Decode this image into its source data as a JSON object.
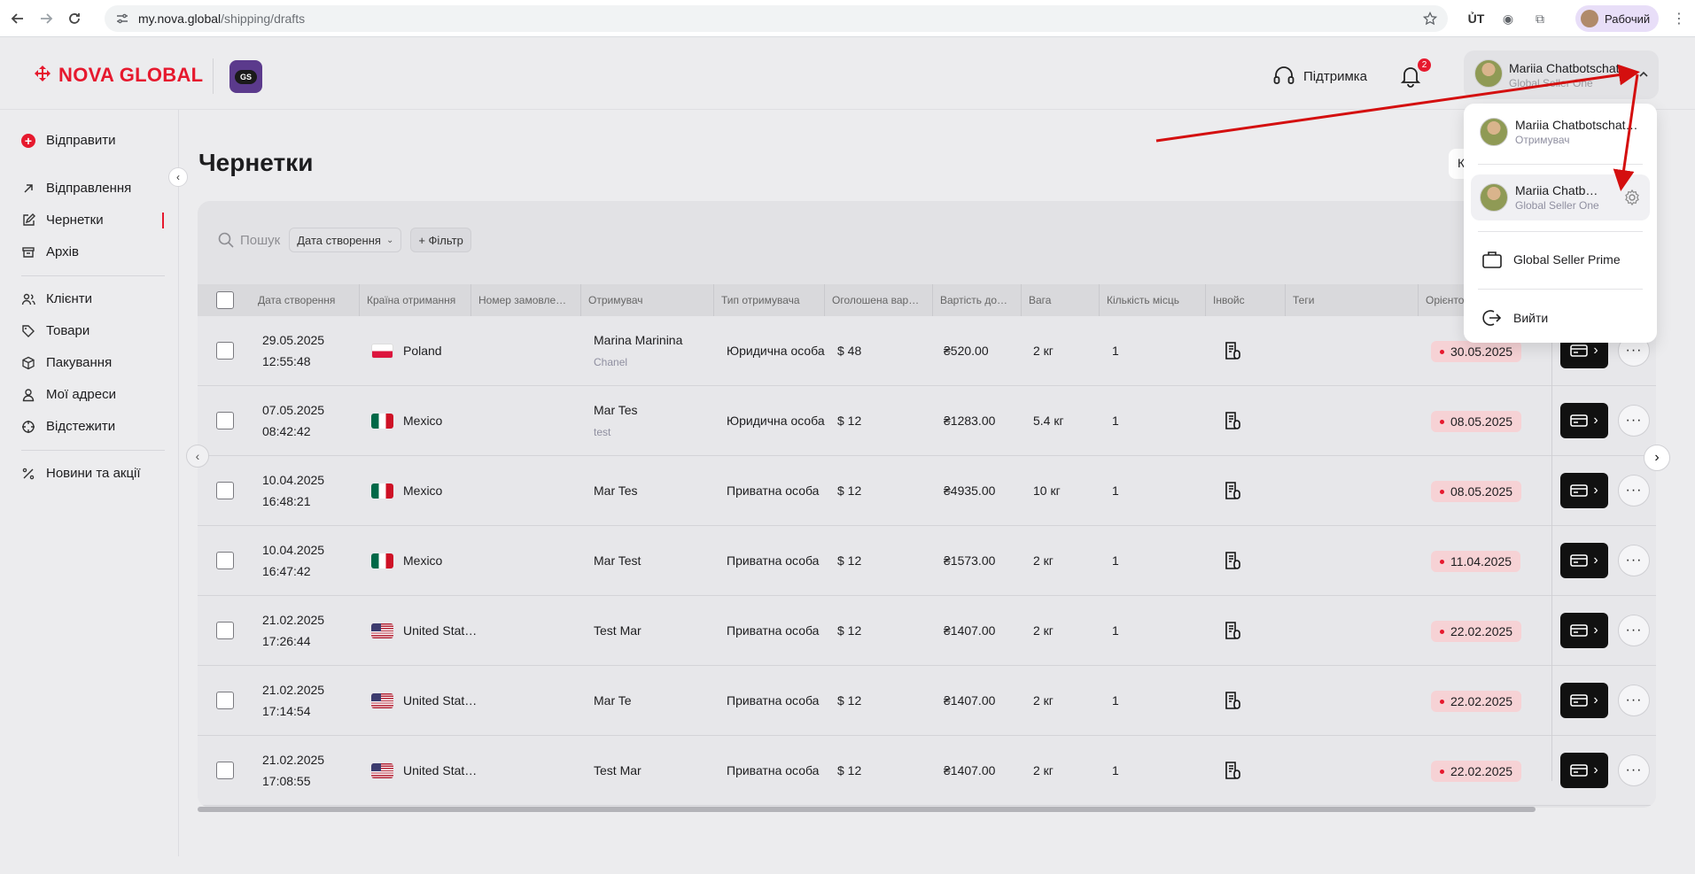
{
  "browser": {
    "url_host": "my.nova.global",
    "url_path": "/shipping/drafts",
    "profile_label": "Рабочий"
  },
  "header": {
    "logo_text": "NOVA GLOBAL",
    "badge_text": "GS",
    "support_label": "Підтримка",
    "notifications_count": "2",
    "user_name": "Mariia Chatbotschat",
    "user_role": "Global Seller One"
  },
  "sidebar": {
    "send_label": "Відправити",
    "items": [
      {
        "label": "Відправлення",
        "icon": "arrow-up-right-icon"
      },
      {
        "label": "Чернетки",
        "icon": "edit-icon"
      },
      {
        "label": "Архів",
        "icon": "archive-icon"
      },
      {
        "label": "Клієнти",
        "icon": "users-icon"
      },
      {
        "label": "Товари",
        "icon": "tag-icon"
      },
      {
        "label": "Пакування",
        "icon": "box-icon"
      },
      {
        "label": "Мої адреси",
        "icon": "location-icon"
      },
      {
        "label": "Відстежити",
        "icon": "target-icon"
      },
      {
        "label": "Новини та акції",
        "icon": "percent-icon"
      }
    ]
  },
  "main": {
    "title": "Чернетки",
    "k_label": "К",
    "search_placeholder": "Пошук",
    "date_filter": "Дата створення",
    "filter_button": "+ Фільтр",
    "columns": [
      "Дата створення",
      "Країна отримання",
      "Номер замовле…",
      "Отримувач",
      "Тип отримувача",
      "Оголошена вар…",
      "Вартість до…",
      "Вага",
      "Кількість місць",
      "Інвойс",
      "Теги",
      "Орієнто"
    ],
    "rows": [
      {
        "date": "29.05.2025",
        "time": "12:55:48",
        "country": "Poland",
        "flag": "pl",
        "recipient": "Marina Marinina",
        "recipient_sub": "Chanel",
        "type": "Юридична особа",
        "declared": "$ 48",
        "cost": "₴520.00",
        "weight": "2 кг",
        "places": "1",
        "eta": "30.05.2025"
      },
      {
        "date": "07.05.2025",
        "time": "08:42:42",
        "country": "Mexico",
        "flag": "mx",
        "recipient": "Mar Tes",
        "recipient_sub": "test",
        "type": "Юридична особа",
        "declared": "$ 12",
        "cost": "₴1283.00",
        "weight": "5.4 кг",
        "places": "1",
        "eta": "08.05.2025"
      },
      {
        "date": "10.04.2025",
        "time": "16:48:21",
        "country": "Mexico",
        "flag": "mx",
        "recipient": "Mar Tes",
        "recipient_sub": "",
        "type": "Приватна особа",
        "declared": "$ 12",
        "cost": "₴4935.00",
        "weight": "10 кг",
        "places": "1",
        "eta": "08.05.2025"
      },
      {
        "date": "10.04.2025",
        "time": "16:47:42",
        "country": "Mexico",
        "flag": "mx",
        "recipient": "Mar Test",
        "recipient_sub": "",
        "type": "Приватна особа",
        "declared": "$ 12",
        "cost": "₴1573.00",
        "weight": "2 кг",
        "places": "1",
        "eta": "11.04.2025"
      },
      {
        "date": "21.02.2025",
        "time": "17:26:44",
        "country": "United Stat…",
        "flag": "us",
        "recipient": "Test Mar",
        "recipient_sub": "",
        "type": "Приватна особа",
        "declared": "$ 12",
        "cost": "₴1407.00",
        "weight": "2 кг",
        "places": "1",
        "eta": "22.02.2025"
      },
      {
        "date": "21.02.2025",
        "time": "17:14:54",
        "country": "United Stat…",
        "flag": "us",
        "recipient": "Mar Te",
        "recipient_sub": "",
        "type": "Приватна особа",
        "declared": "$ 12",
        "cost": "₴1407.00",
        "weight": "2 кг",
        "places": "1",
        "eta": "22.02.2025"
      },
      {
        "date": "21.02.2025",
        "time": "17:08:55",
        "country": "United Stat…",
        "flag": "us",
        "recipient": "Test Mar",
        "recipient_sub": "",
        "type": "Приватна особа",
        "declared": "$ 12",
        "cost": "₴1407.00",
        "weight": "2 кг",
        "places": "1",
        "eta": "22.02.2025"
      }
    ]
  },
  "dropdown": {
    "account1_name": "Mariia Chatbotschat…",
    "account1_role": "Отримувач",
    "account2_name": "Mariia Chatb…",
    "account2_role": "Global Seller One",
    "workspace_label": "Global Seller Prime",
    "logout_label": "Вийти"
  },
  "colors": {
    "brand_red": "#e6192e",
    "annotation_arrow": "#d40f0f"
  }
}
